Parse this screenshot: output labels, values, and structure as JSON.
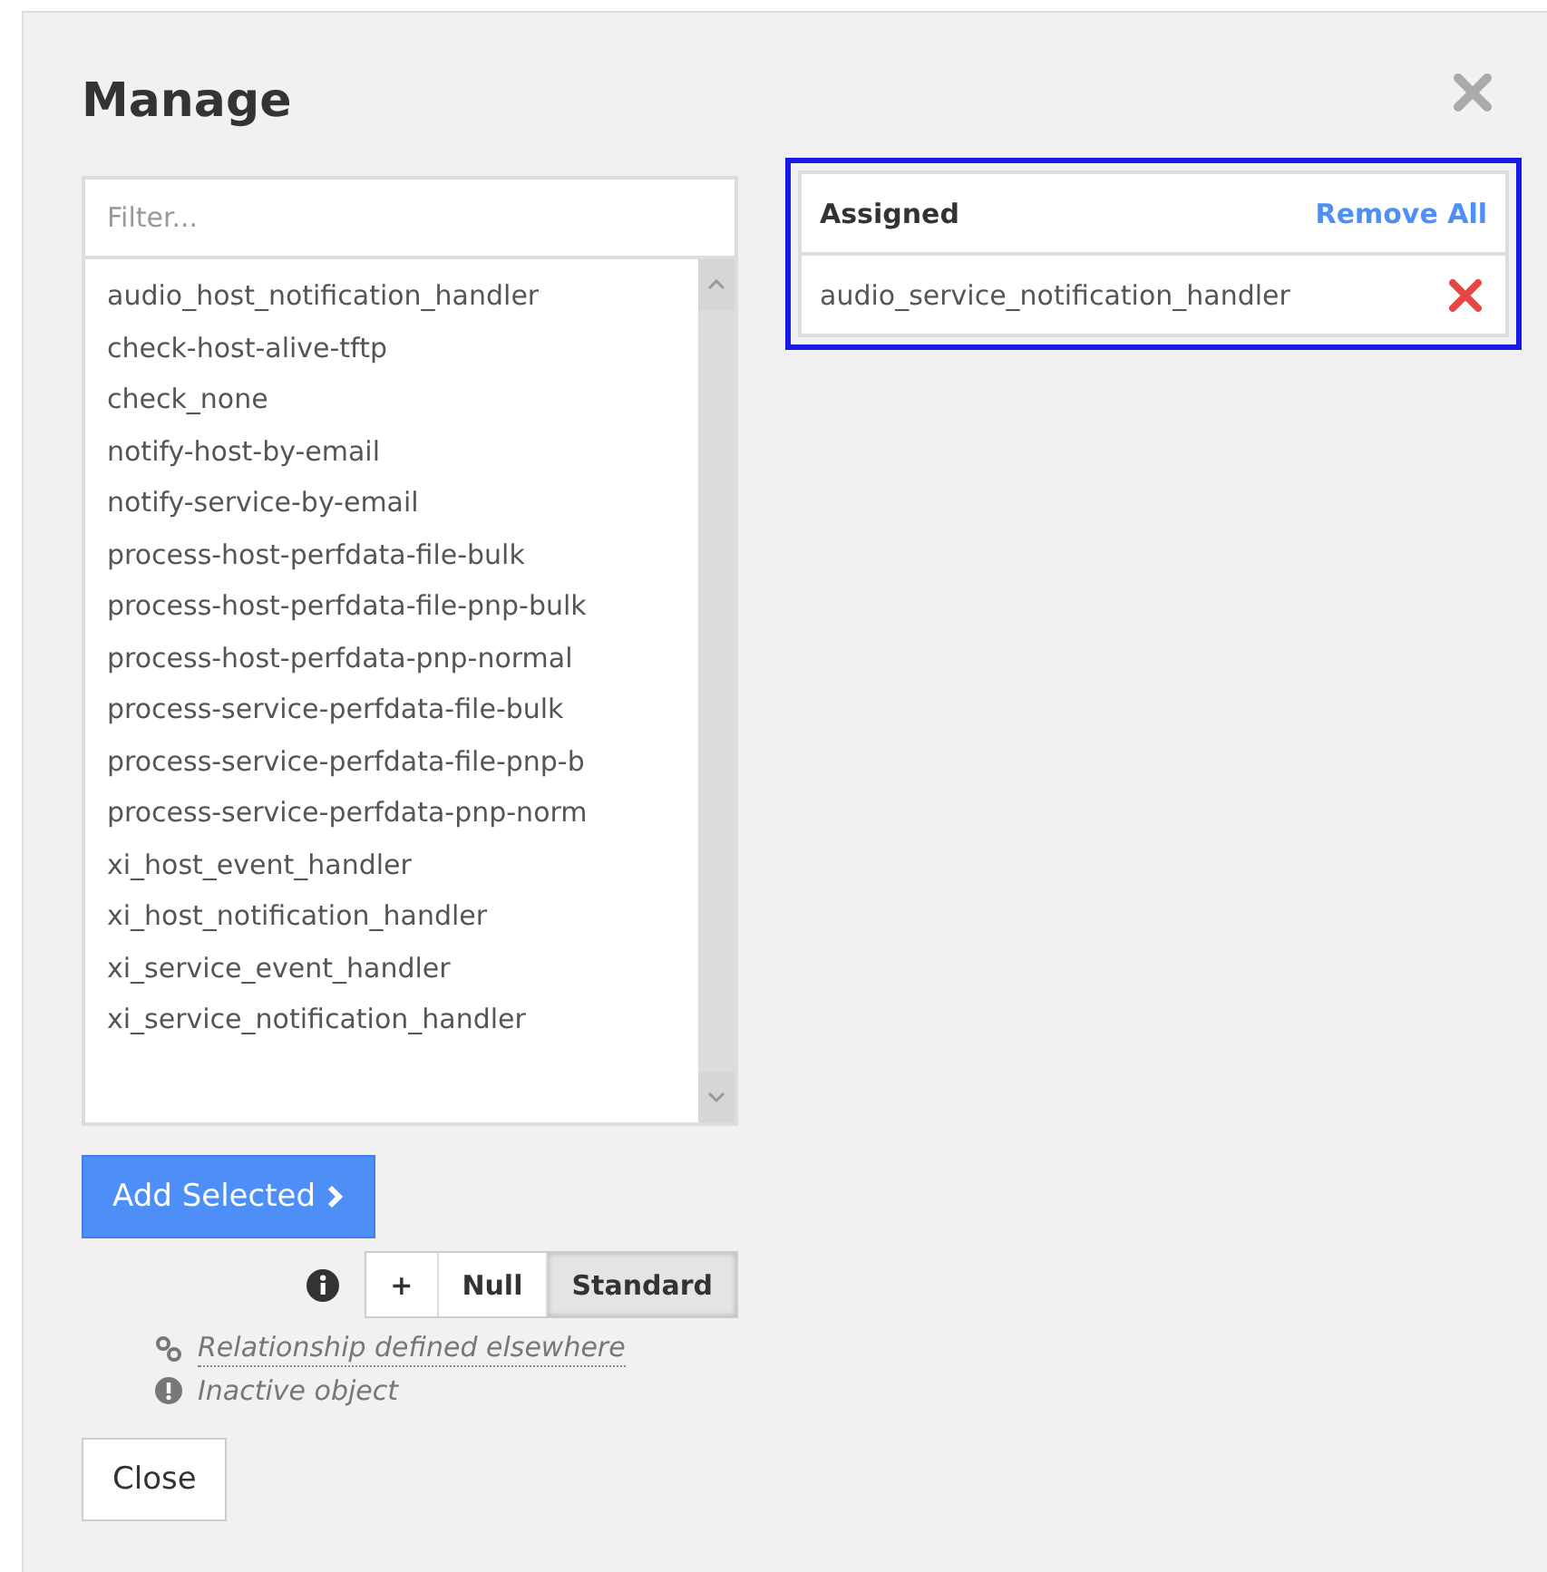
{
  "dialog": {
    "title": "Manage"
  },
  "filter": {
    "placeholder": "Filter..."
  },
  "available": [
    "audio_host_notification_handler",
    "check-host-alive-tftp",
    "check_none",
    "notify-host-by-email",
    "notify-service-by-email",
    "process-host-perfdata-file-bulk",
    "process-host-perfdata-file-pnp-bulk",
    "process-host-perfdata-pnp-normal",
    "process-service-perfdata-file-bulk",
    "process-service-perfdata-file-pnp-b",
    "process-service-perfdata-pnp-norm",
    "xi_host_event_handler",
    "xi_host_notification_handler",
    "xi_service_event_handler",
    "xi_service_notification_handler"
  ],
  "add_button": {
    "label": "Add Selected"
  },
  "modes": [
    {
      "label": "+",
      "selected": false
    },
    {
      "label": "Null",
      "selected": false
    },
    {
      "label": "Standard",
      "selected": true
    }
  ],
  "legend": [
    {
      "kind": "link",
      "text": "Relationship defined elsewhere"
    },
    {
      "kind": "inactive",
      "text": "Inactive object"
    }
  ],
  "close_button": {
    "label": "Close"
  },
  "assigned": {
    "heading": "Assigned",
    "remove_all": "Remove All",
    "items": [
      "audio_service_notification_handler"
    ]
  }
}
